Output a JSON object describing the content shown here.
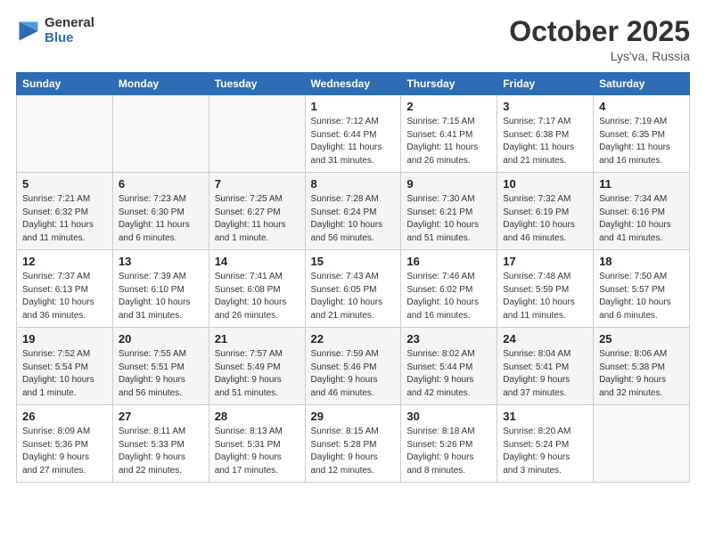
{
  "header": {
    "logo_line1": "General",
    "logo_line2": "Blue",
    "month": "October 2025",
    "location": "Lys'va, Russia"
  },
  "weekdays": [
    "Sunday",
    "Monday",
    "Tuesday",
    "Wednesday",
    "Thursday",
    "Friday",
    "Saturday"
  ],
  "weeks": [
    [
      {
        "day": "",
        "info": ""
      },
      {
        "day": "",
        "info": ""
      },
      {
        "day": "",
        "info": ""
      },
      {
        "day": "1",
        "info": "Sunrise: 7:12 AM\nSunset: 6:44 PM\nDaylight: 11 hours\nand 31 minutes."
      },
      {
        "day": "2",
        "info": "Sunrise: 7:15 AM\nSunset: 6:41 PM\nDaylight: 11 hours\nand 26 minutes."
      },
      {
        "day": "3",
        "info": "Sunrise: 7:17 AM\nSunset: 6:38 PM\nDaylight: 11 hours\nand 21 minutes."
      },
      {
        "day": "4",
        "info": "Sunrise: 7:19 AM\nSunset: 6:35 PM\nDaylight: 11 hours\nand 16 minutes."
      }
    ],
    [
      {
        "day": "5",
        "info": "Sunrise: 7:21 AM\nSunset: 6:32 PM\nDaylight: 11 hours\nand 11 minutes."
      },
      {
        "day": "6",
        "info": "Sunrise: 7:23 AM\nSunset: 6:30 PM\nDaylight: 11 hours\nand 6 minutes."
      },
      {
        "day": "7",
        "info": "Sunrise: 7:25 AM\nSunset: 6:27 PM\nDaylight: 11 hours\nand 1 minute."
      },
      {
        "day": "8",
        "info": "Sunrise: 7:28 AM\nSunset: 6:24 PM\nDaylight: 10 hours\nand 56 minutes."
      },
      {
        "day": "9",
        "info": "Sunrise: 7:30 AM\nSunset: 6:21 PM\nDaylight: 10 hours\nand 51 minutes."
      },
      {
        "day": "10",
        "info": "Sunrise: 7:32 AM\nSunset: 6:19 PM\nDaylight: 10 hours\nand 46 minutes."
      },
      {
        "day": "11",
        "info": "Sunrise: 7:34 AM\nSunset: 6:16 PM\nDaylight: 10 hours\nand 41 minutes."
      }
    ],
    [
      {
        "day": "12",
        "info": "Sunrise: 7:37 AM\nSunset: 6:13 PM\nDaylight: 10 hours\nand 36 minutes."
      },
      {
        "day": "13",
        "info": "Sunrise: 7:39 AM\nSunset: 6:10 PM\nDaylight: 10 hours\nand 31 minutes."
      },
      {
        "day": "14",
        "info": "Sunrise: 7:41 AM\nSunset: 6:08 PM\nDaylight: 10 hours\nand 26 minutes."
      },
      {
        "day": "15",
        "info": "Sunrise: 7:43 AM\nSunset: 6:05 PM\nDaylight: 10 hours\nand 21 minutes."
      },
      {
        "day": "16",
        "info": "Sunrise: 7:46 AM\nSunset: 6:02 PM\nDaylight: 10 hours\nand 16 minutes."
      },
      {
        "day": "17",
        "info": "Sunrise: 7:48 AM\nSunset: 5:59 PM\nDaylight: 10 hours\nand 11 minutes."
      },
      {
        "day": "18",
        "info": "Sunrise: 7:50 AM\nSunset: 5:57 PM\nDaylight: 10 hours\nand 6 minutes."
      }
    ],
    [
      {
        "day": "19",
        "info": "Sunrise: 7:52 AM\nSunset: 5:54 PM\nDaylight: 10 hours\nand 1 minute."
      },
      {
        "day": "20",
        "info": "Sunrise: 7:55 AM\nSunset: 5:51 PM\nDaylight: 9 hours\nand 56 minutes."
      },
      {
        "day": "21",
        "info": "Sunrise: 7:57 AM\nSunset: 5:49 PM\nDaylight: 9 hours\nand 51 minutes."
      },
      {
        "day": "22",
        "info": "Sunrise: 7:59 AM\nSunset: 5:46 PM\nDaylight: 9 hours\nand 46 minutes."
      },
      {
        "day": "23",
        "info": "Sunrise: 8:02 AM\nSunset: 5:44 PM\nDaylight: 9 hours\nand 42 minutes."
      },
      {
        "day": "24",
        "info": "Sunrise: 8:04 AM\nSunset: 5:41 PM\nDaylight: 9 hours\nand 37 minutes."
      },
      {
        "day": "25",
        "info": "Sunrise: 8:06 AM\nSunset: 5:38 PM\nDaylight: 9 hours\nand 32 minutes."
      }
    ],
    [
      {
        "day": "26",
        "info": "Sunrise: 8:09 AM\nSunset: 5:36 PM\nDaylight: 9 hours\nand 27 minutes."
      },
      {
        "day": "27",
        "info": "Sunrise: 8:11 AM\nSunset: 5:33 PM\nDaylight: 9 hours\nand 22 minutes."
      },
      {
        "day": "28",
        "info": "Sunrise: 8:13 AM\nSunset: 5:31 PM\nDaylight: 9 hours\nand 17 minutes."
      },
      {
        "day": "29",
        "info": "Sunrise: 8:15 AM\nSunset: 5:28 PM\nDaylight: 9 hours\nand 12 minutes."
      },
      {
        "day": "30",
        "info": "Sunrise: 8:18 AM\nSunset: 5:26 PM\nDaylight: 9 hours\nand 8 minutes."
      },
      {
        "day": "31",
        "info": "Sunrise: 8:20 AM\nSunset: 5:24 PM\nDaylight: 9 hours\nand 3 minutes."
      },
      {
        "day": "",
        "info": ""
      }
    ]
  ]
}
